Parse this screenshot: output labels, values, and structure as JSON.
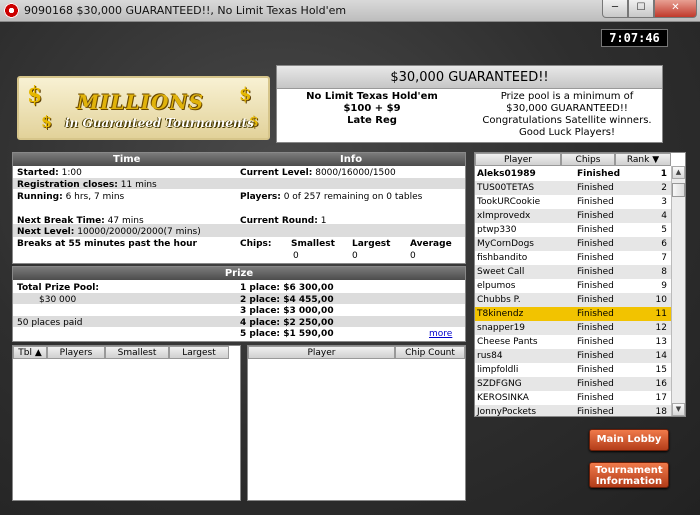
{
  "window": {
    "title": "9090168 $30,000 GUARANTEED!!, No Limit Texas Hold'em",
    "min_glyph": "─",
    "max_glyph": "☐",
    "close_glyph": "✕"
  },
  "clock": "7:07:46",
  "logo": {
    "line1": "MILLIONS",
    "line2": "in Guaranteed Tournaments"
  },
  "header": {
    "title": "$30,000 GUARANTEED!!",
    "game": "No Limit Texas Hold'em",
    "buyin": "$100 + $9",
    "status": "Late Reg",
    "message_lines": [
      "Prize pool is a minimum of",
      "$30,000 GUARANTEED!!",
      "Congratulations Satellite winners.",
      "Good Luck Players!"
    ]
  },
  "time_panel": {
    "title": "Time",
    "started_label": "Started:",
    "started_value": "1:00",
    "reg_label": "Registration closes:",
    "reg_value": "11 mins",
    "running_label": "Running:",
    "running_value": "6 hrs, 7 mins",
    "next_break_label": "Next Break Time:",
    "next_break_value": "47 mins",
    "next_level_label": "Next Level:",
    "next_level_value": "10000/20000/2000(7 mins)",
    "breaks_text": "Breaks at 55 minutes past the hour"
  },
  "info_panel": {
    "title": "Info",
    "current_level_label": "Current Level:",
    "current_level_value": "8000/16000/1500",
    "players_label": "Players:",
    "players_value": "0 of 257 remaining on 0 tables",
    "current_round_label": "Current Round:",
    "current_round_value": "1",
    "chips_label": "Chips:",
    "smallest_label": "Smallest",
    "smallest_value": "0",
    "largest_label": "Largest",
    "largest_value": "0",
    "average_label": "Average",
    "average_value": "0"
  },
  "prize_panel": {
    "title": "Prize",
    "pool_label": "Total Prize Pool:",
    "pool_value": "$30 000",
    "places_paid": "50 places paid",
    "places": [
      {
        "label": "1 place:",
        "amount": "$6 300,00"
      },
      {
        "label": "2 place:",
        "amount": "$4 455,00"
      },
      {
        "label": "3 place:",
        "amount": "$3 000,00"
      },
      {
        "label": "4 place:",
        "amount": "$2 250,00"
      },
      {
        "label": "5 place:",
        "amount": "$1 590,00"
      }
    ],
    "more_link": "more"
  },
  "tables_list": {
    "columns": [
      "Tbl ▲",
      "Players",
      "Smallest",
      "Largest"
    ]
  },
  "players_list": {
    "columns": [
      "Player",
      "Chip Count"
    ]
  },
  "ranking": {
    "columns": [
      "Player",
      "Chips",
      "Rank ▼"
    ],
    "rows": [
      {
        "name": "Aleks01989",
        "status": "Finished",
        "rank": "1"
      },
      {
        "name": "TUS00TETAS",
        "status": "Finished",
        "rank": "2"
      },
      {
        "name": "TookURCookie",
        "status": "Finished",
        "rank": "3"
      },
      {
        "name": "xImprovedx",
        "status": "Finished",
        "rank": "4"
      },
      {
        "name": "ptwp330",
        "status": "Finished",
        "rank": "5"
      },
      {
        "name": "MyCornDogs",
        "status": "Finished",
        "rank": "6"
      },
      {
        "name": "fishbandito",
        "status": "Finished",
        "rank": "7"
      },
      {
        "name": "Sweet Call",
        "status": "Finished",
        "rank": "8"
      },
      {
        "name": "elpumos",
        "status": "Finished",
        "rank": "9"
      },
      {
        "name": "Chubbs P.",
        "status": "Finished",
        "rank": "10"
      },
      {
        "name": "T8kinendz",
        "status": "Finished",
        "rank": "11"
      },
      {
        "name": "snapper19",
        "status": "Finished",
        "rank": "12"
      },
      {
        "name": "Cheese Pants",
        "status": "Finished",
        "rank": "13"
      },
      {
        "name": "rus84",
        "status": "Finished",
        "rank": "14"
      },
      {
        "name": "limpfoldli",
        "status": "Finished",
        "rank": "15"
      },
      {
        "name": "SZDFGNG",
        "status": "Finished",
        "rank": "16"
      },
      {
        "name": "KEROSINKA",
        "status": "Finished",
        "rank": "17"
      },
      {
        "name": "JonnyPockets",
        "status": "Finished",
        "rank": "18"
      }
    ]
  },
  "buttons": {
    "main_lobby": "Main Lobby",
    "tournament_info_line1": "Tournament",
    "tournament_info_line2": "Information"
  }
}
